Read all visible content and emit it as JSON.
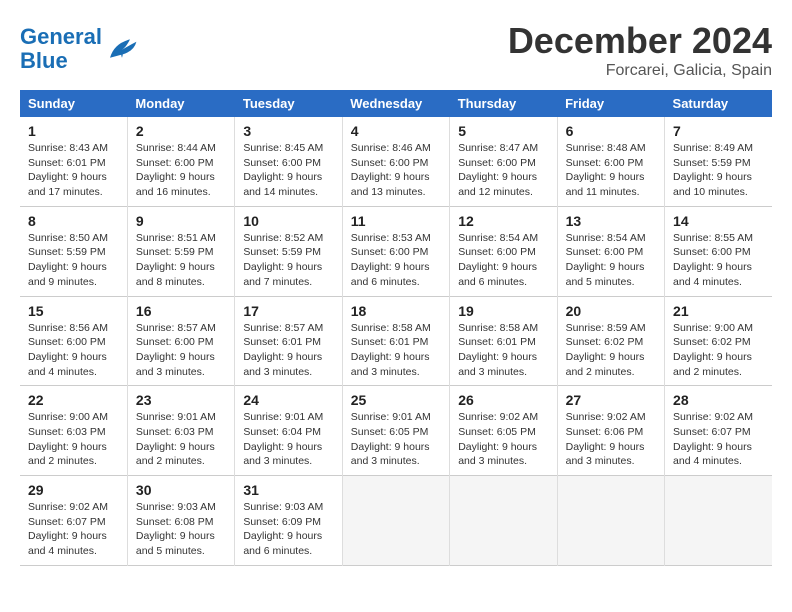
{
  "header": {
    "logo_line1": "General",
    "logo_line2": "Blue",
    "title": "December 2024",
    "subtitle": "Forcarei, Galicia, Spain"
  },
  "days_of_week": [
    "Sunday",
    "Monday",
    "Tuesday",
    "Wednesday",
    "Thursday",
    "Friday",
    "Saturday"
  ],
  "weeks": [
    [
      {
        "day": "1",
        "sunrise": "8:43 AM",
        "sunset": "6:01 PM",
        "daylight": "9 hours and 17 minutes."
      },
      {
        "day": "2",
        "sunrise": "8:44 AM",
        "sunset": "6:00 PM",
        "daylight": "9 hours and 16 minutes."
      },
      {
        "day": "3",
        "sunrise": "8:45 AM",
        "sunset": "6:00 PM",
        "daylight": "9 hours and 14 minutes."
      },
      {
        "day": "4",
        "sunrise": "8:46 AM",
        "sunset": "6:00 PM",
        "daylight": "9 hours and 13 minutes."
      },
      {
        "day": "5",
        "sunrise": "8:47 AM",
        "sunset": "6:00 PM",
        "daylight": "9 hours and 12 minutes."
      },
      {
        "day": "6",
        "sunrise": "8:48 AM",
        "sunset": "6:00 PM",
        "daylight": "9 hours and 11 minutes."
      },
      {
        "day": "7",
        "sunrise": "8:49 AM",
        "sunset": "5:59 PM",
        "daylight": "9 hours and 10 minutes."
      }
    ],
    [
      {
        "day": "8",
        "sunrise": "8:50 AM",
        "sunset": "5:59 PM",
        "daylight": "9 hours and 9 minutes."
      },
      {
        "day": "9",
        "sunrise": "8:51 AM",
        "sunset": "5:59 PM",
        "daylight": "9 hours and 8 minutes."
      },
      {
        "day": "10",
        "sunrise": "8:52 AM",
        "sunset": "5:59 PM",
        "daylight": "9 hours and 7 minutes."
      },
      {
        "day": "11",
        "sunrise": "8:53 AM",
        "sunset": "6:00 PM",
        "daylight": "9 hours and 6 minutes."
      },
      {
        "day": "12",
        "sunrise": "8:54 AM",
        "sunset": "6:00 PM",
        "daylight": "9 hours and 6 minutes."
      },
      {
        "day": "13",
        "sunrise": "8:54 AM",
        "sunset": "6:00 PM",
        "daylight": "9 hours and 5 minutes."
      },
      {
        "day": "14",
        "sunrise": "8:55 AM",
        "sunset": "6:00 PM",
        "daylight": "9 hours and 4 minutes."
      }
    ],
    [
      {
        "day": "15",
        "sunrise": "8:56 AM",
        "sunset": "6:00 PM",
        "daylight": "9 hours and 4 minutes."
      },
      {
        "day": "16",
        "sunrise": "8:57 AM",
        "sunset": "6:00 PM",
        "daylight": "9 hours and 3 minutes."
      },
      {
        "day": "17",
        "sunrise": "8:57 AM",
        "sunset": "6:01 PM",
        "daylight": "9 hours and 3 minutes."
      },
      {
        "day": "18",
        "sunrise": "8:58 AM",
        "sunset": "6:01 PM",
        "daylight": "9 hours and 3 minutes."
      },
      {
        "day": "19",
        "sunrise": "8:58 AM",
        "sunset": "6:01 PM",
        "daylight": "9 hours and 3 minutes."
      },
      {
        "day": "20",
        "sunrise": "8:59 AM",
        "sunset": "6:02 PM",
        "daylight": "9 hours and 2 minutes."
      },
      {
        "day": "21",
        "sunrise": "9:00 AM",
        "sunset": "6:02 PM",
        "daylight": "9 hours and 2 minutes."
      }
    ],
    [
      {
        "day": "22",
        "sunrise": "9:00 AM",
        "sunset": "6:03 PM",
        "daylight": "9 hours and 2 minutes."
      },
      {
        "day": "23",
        "sunrise": "9:01 AM",
        "sunset": "6:03 PM",
        "daylight": "9 hours and 2 minutes."
      },
      {
        "day": "24",
        "sunrise": "9:01 AM",
        "sunset": "6:04 PM",
        "daylight": "9 hours and 3 minutes."
      },
      {
        "day": "25",
        "sunrise": "9:01 AM",
        "sunset": "6:05 PM",
        "daylight": "9 hours and 3 minutes."
      },
      {
        "day": "26",
        "sunrise": "9:02 AM",
        "sunset": "6:05 PM",
        "daylight": "9 hours and 3 minutes."
      },
      {
        "day": "27",
        "sunrise": "9:02 AM",
        "sunset": "6:06 PM",
        "daylight": "9 hours and 3 minutes."
      },
      {
        "day": "28",
        "sunrise": "9:02 AM",
        "sunset": "6:07 PM",
        "daylight": "9 hours and 4 minutes."
      }
    ],
    [
      {
        "day": "29",
        "sunrise": "9:02 AM",
        "sunset": "6:07 PM",
        "daylight": "9 hours and 4 minutes."
      },
      {
        "day": "30",
        "sunrise": "9:03 AM",
        "sunset": "6:08 PM",
        "daylight": "9 hours and 5 minutes."
      },
      {
        "day": "31",
        "sunrise": "9:03 AM",
        "sunset": "6:09 PM",
        "daylight": "9 hours and 6 minutes."
      },
      null,
      null,
      null,
      null
    ]
  ],
  "labels": {
    "sunrise": "Sunrise:",
    "sunset": "Sunset:",
    "daylight": "Daylight:"
  }
}
